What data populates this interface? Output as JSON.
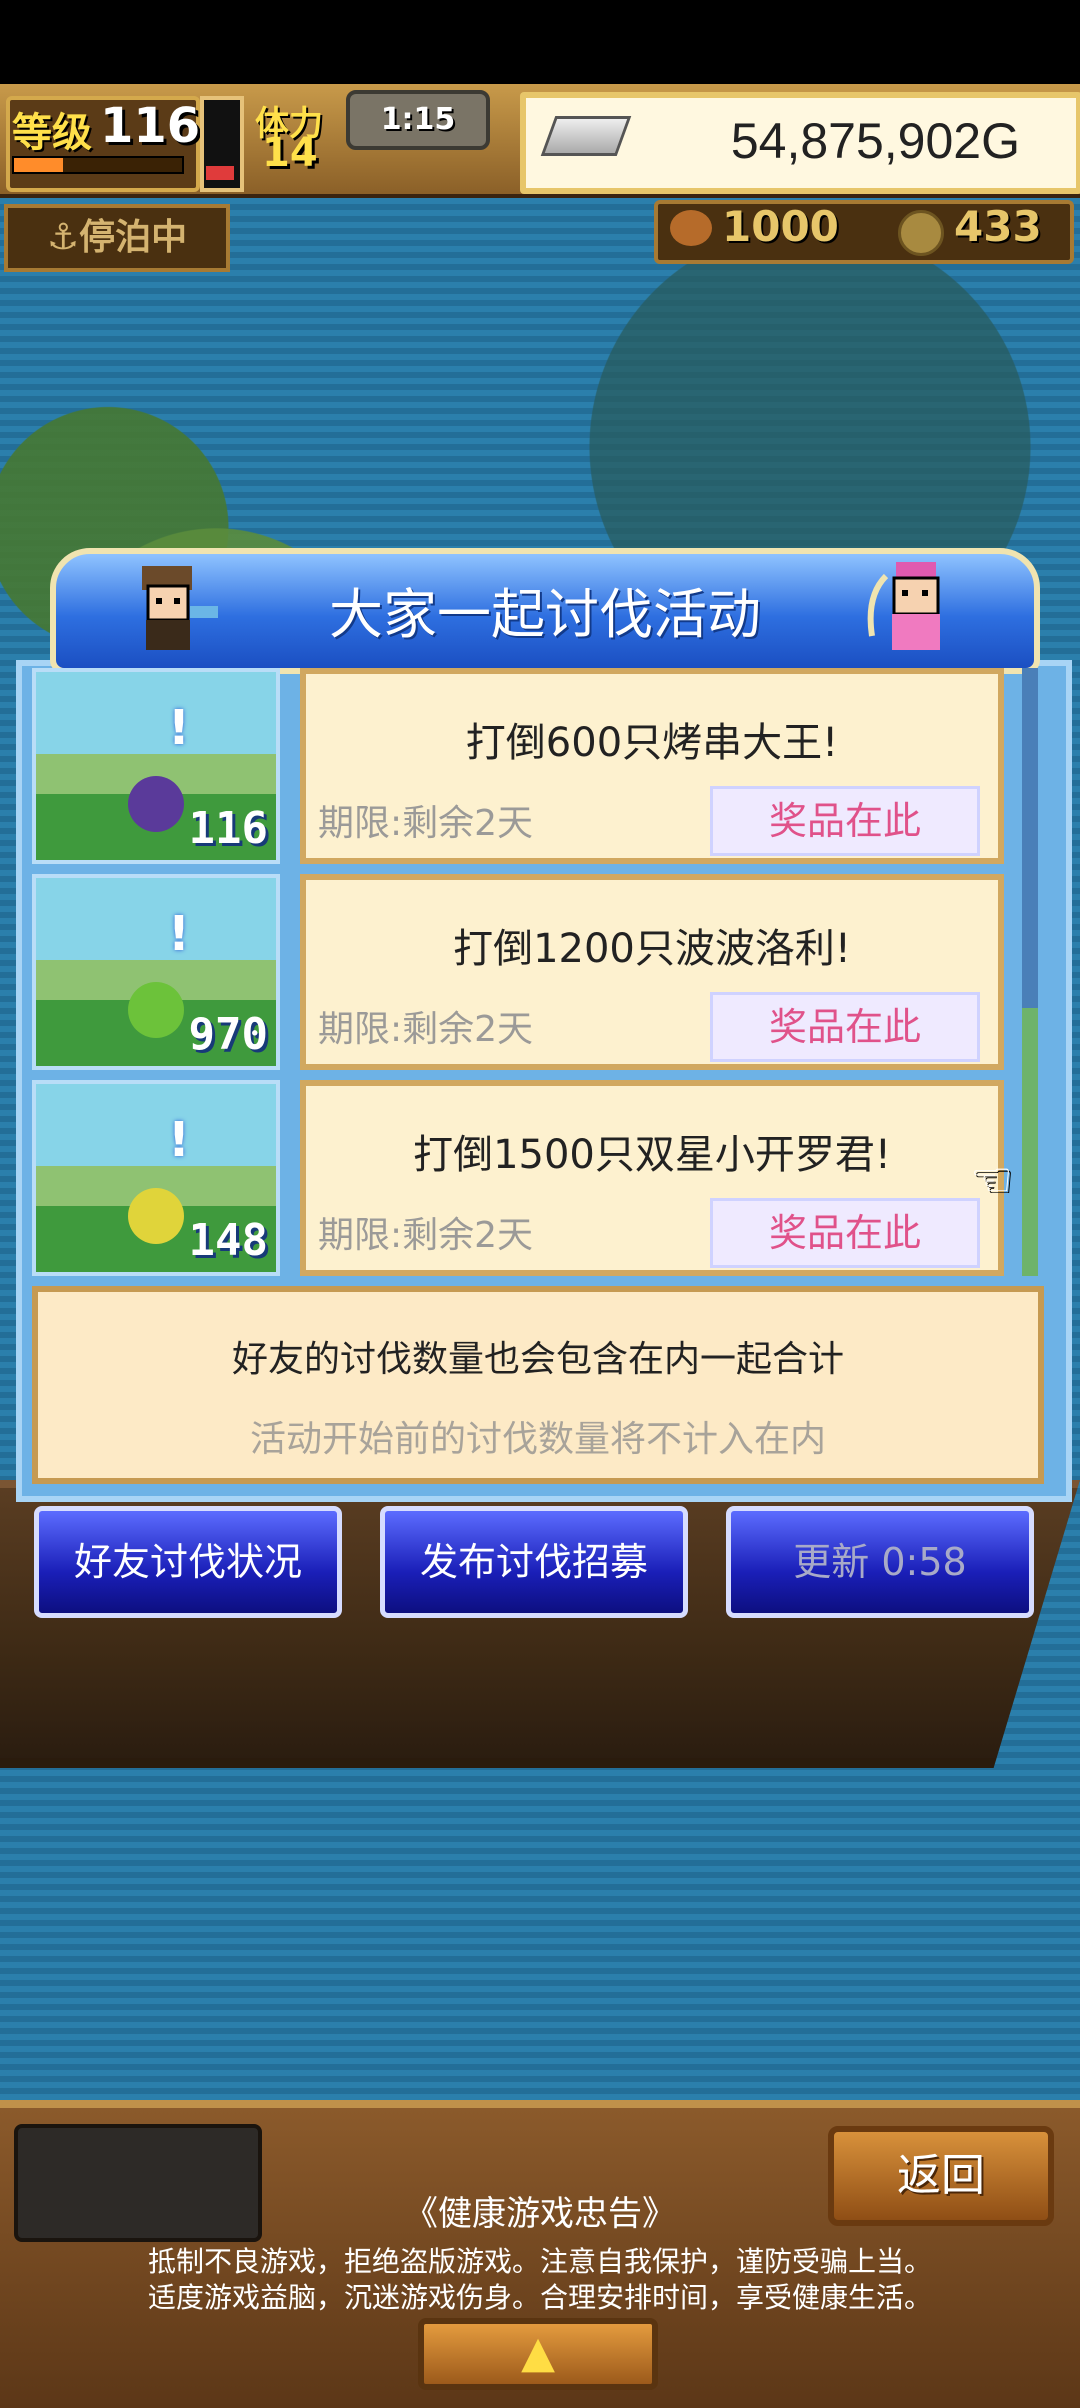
{
  "hud": {
    "level_label": "等级",
    "level_value": "116",
    "exp_fraction": 0.3,
    "stamina_label": "体力",
    "stamina_value": "14",
    "timer": "1:15",
    "gold": "54,875,902G",
    "anchor_status": "停泊中",
    "resource_1": "1000",
    "resource_2": "433"
  },
  "dialog": {
    "title": "大家一起讨伐活动",
    "events": [
      {
        "title": "打倒600只烤串大王!",
        "deadline": "期限:剩余2天",
        "prize_label": "奖品在此",
        "count": "116",
        "sprite_color": "#5a3a9a"
      },
      {
        "title": "打倒1200只波波洛利!",
        "deadline": "期限:剩余2天",
        "prize_label": "奖品在此",
        "count": "970",
        "sprite_color": "#6cc23a"
      },
      {
        "title": "打倒1500只双星小开罗君!",
        "deadline": "期限:剩余2天",
        "prize_label": "奖品在此",
        "count": "148",
        "sprite_color": "#e0d43a"
      }
    ],
    "notice_line1": "好友的讨伐数量也会包含在内一起合计",
    "notice_line2": "活动开始前的讨伐数量将不计入在内"
  },
  "buttons": {
    "friend_status": "好友讨伐状况",
    "post_recruit": "发布讨伐招募",
    "refresh": "更新 0:58"
  },
  "footer": {
    "back_label": "返回",
    "advisory_title": "《健康游戏忠告》",
    "advisory_line1": "抵制不良游戏，拒绝盗版游戏。注意自我保护，谨防受骗上当。",
    "advisory_line2": "适度游戏益脑，沉迷游戏伤身。合理安排时间，享受健康生活。",
    "up_arrow": "▲"
  },
  "colors": {
    "dialog_blue": "#2e6fe0",
    "prize_text": "#e0528a",
    "card_bg": "#fdf1cf"
  }
}
